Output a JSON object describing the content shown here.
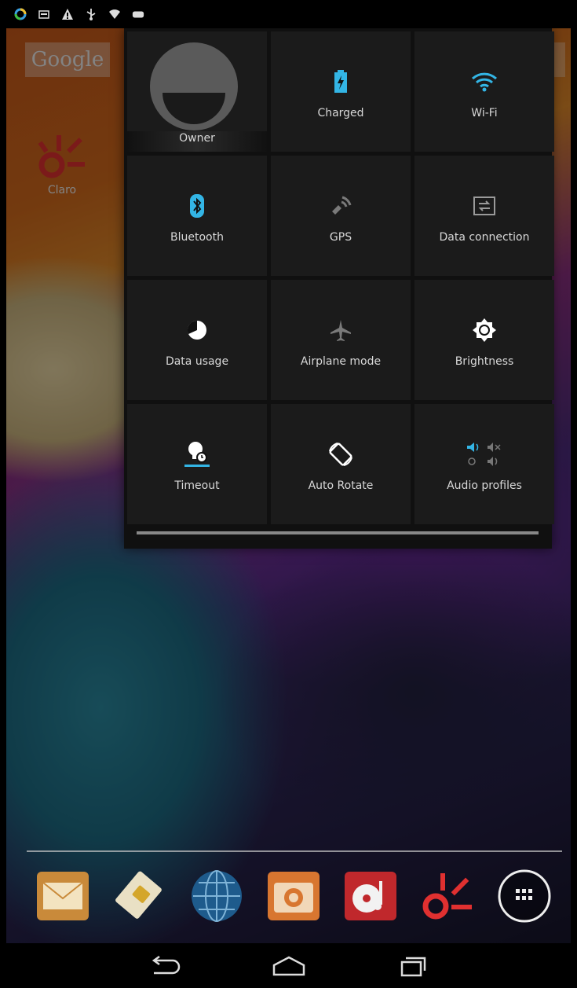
{
  "status_bar": {
    "icons": [
      "sync-icon",
      "sim-icon",
      "warning-icon",
      "usb-icon",
      "wifi-question-icon",
      "android-debug-icon"
    ]
  },
  "home": {
    "search_label": "Google",
    "desktop_icons": [
      {
        "label": "Claro",
        "icon": "claro-logo-icon"
      }
    ]
  },
  "quick_settings": {
    "owner": {
      "label": "Owner"
    },
    "tiles": [
      {
        "label": "Charged",
        "icon": "battery-charging-icon",
        "color": "#33b5e5"
      },
      {
        "label": "Wi-Fi",
        "icon": "wifi-icon",
        "color": "#33b5e5"
      },
      {
        "label": "Bluetooth",
        "icon": "bluetooth-icon",
        "color": "#33b5e5"
      },
      {
        "label": "GPS",
        "icon": "gps-icon",
        "color": "#7a7a7a"
      },
      {
        "label": "Data connection",
        "icon": "data-connection-icon",
        "color": "#9a9a9a"
      },
      {
        "label": "Data usage",
        "icon": "data-usage-icon",
        "color": "#ffffff"
      },
      {
        "label": "Airplane mode",
        "icon": "airplane-icon",
        "color": "#7a7a7a"
      },
      {
        "label": "Brightness",
        "icon": "brightness-icon",
        "color": "#ffffff"
      },
      {
        "label": "Timeout",
        "icon": "timeout-icon",
        "color": "#ffffff"
      },
      {
        "label": "Auto Rotate",
        "icon": "auto-rotate-icon",
        "color": "#ffffff"
      },
      {
        "label": "Audio profiles",
        "icon": "audio-profiles-icon",
        "color": "#33b5e5"
      }
    ]
  },
  "dock": {
    "apps": [
      "mail-icon",
      "sim-toolkit-icon",
      "browser-globe-icon",
      "camera-icon",
      "music-icon",
      "claro-logo-icon",
      "app-drawer-icon"
    ]
  },
  "nav_bar": {
    "buttons": [
      "back-icon",
      "home-icon",
      "recents-icon"
    ]
  }
}
